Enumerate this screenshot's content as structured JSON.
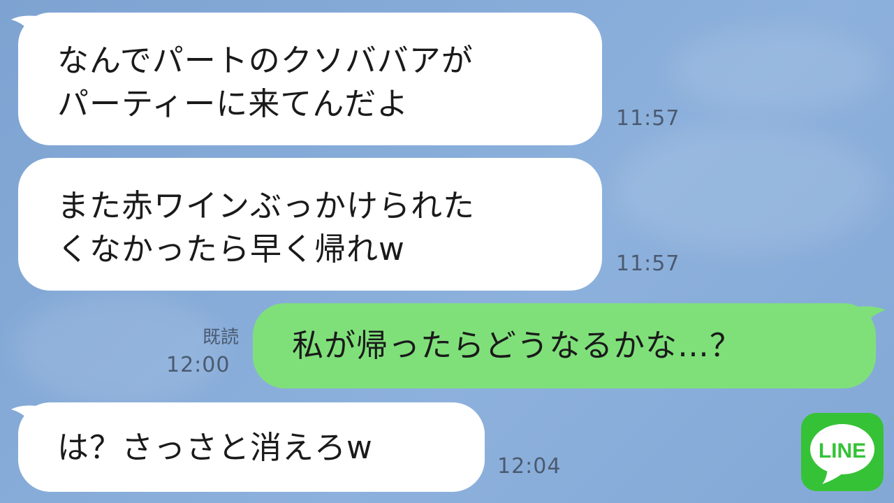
{
  "messages": [
    {
      "side": "in",
      "lines": [
        "なんでパートのクソババアが",
        "パーティーに来てんだよ"
      ],
      "time": "11:57"
    },
    {
      "side": "in",
      "lines": [
        "また赤ワインぶっかけられた",
        "くなかったら早く帰れw"
      ],
      "time": "11:57"
    },
    {
      "side": "out",
      "lines": [
        "私が帰ったらどうなるかな…？"
      ],
      "read": "既読",
      "time": "12:00"
    },
    {
      "side": "in",
      "lines": [
        "は？さっさと消えろw"
      ],
      "time": "12:04"
    }
  ],
  "logo": {
    "text": "LINE",
    "color": "#36c237"
  },
  "colors": {
    "incoming_bubble": "#ffffff",
    "outgoing_bubble": "#7fe07a",
    "background": "#86abd8"
  }
}
